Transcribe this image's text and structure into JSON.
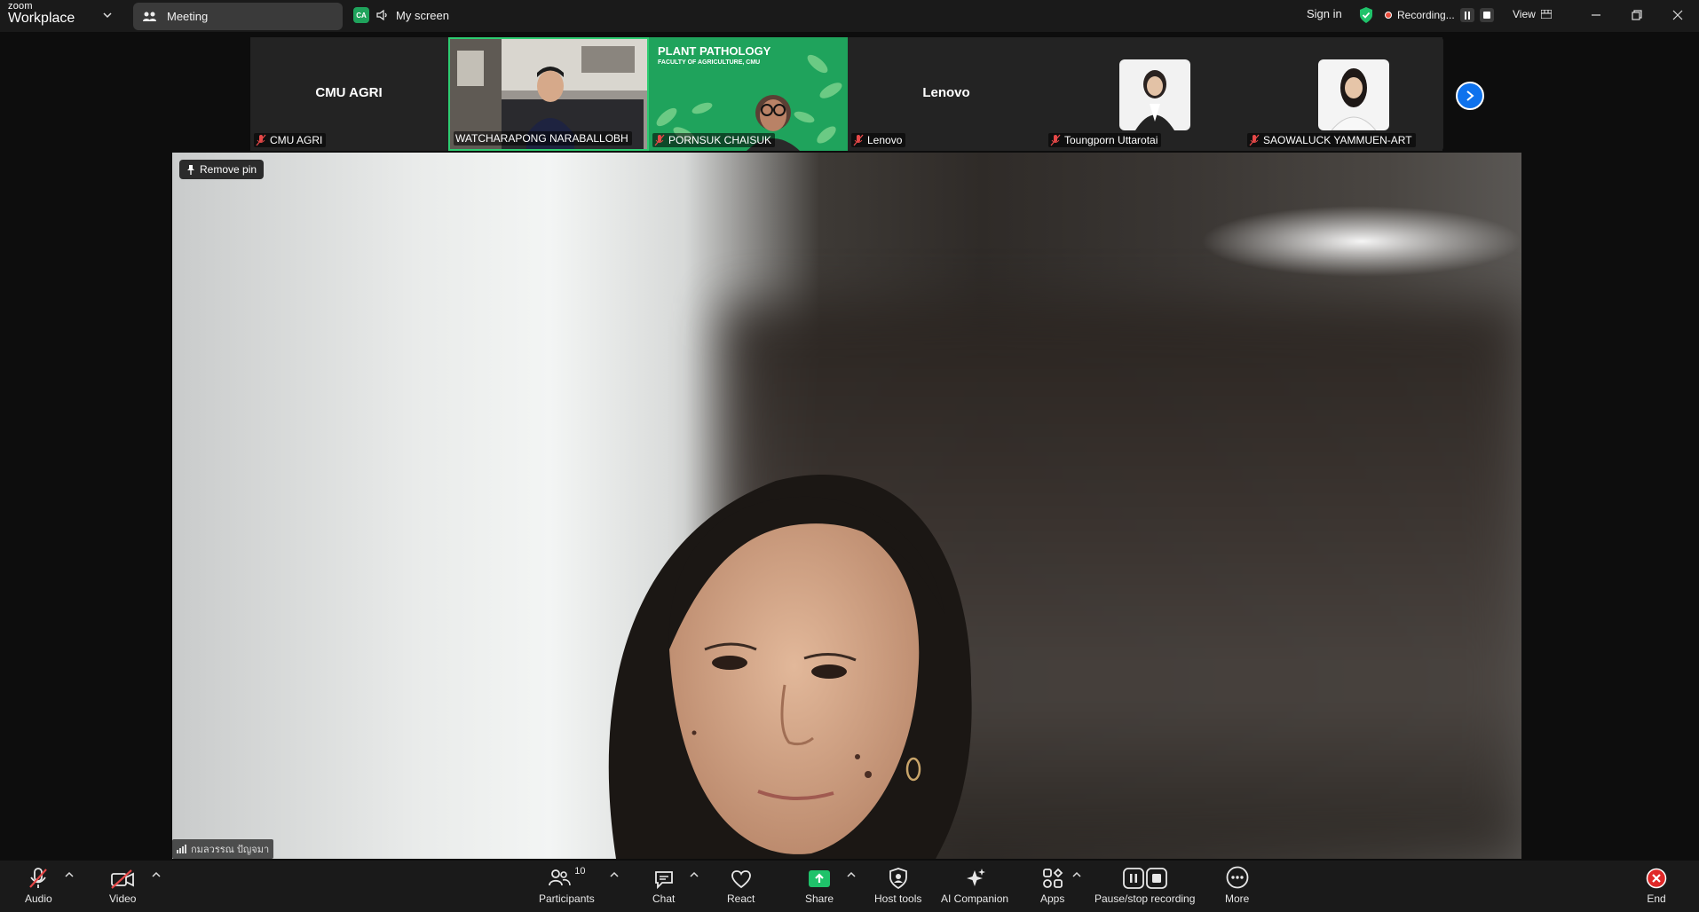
{
  "titlebar": {
    "logo_top": "zoom",
    "logo_bottom": "Workplace",
    "meeting_tab": "Meeting",
    "share_badge": "CA",
    "my_screen": "My screen",
    "sign_in": "Sign in",
    "recording": "Recording...",
    "view": "View"
  },
  "participants_strip": [
    {
      "name": "CMU AGRI",
      "display_name": "CMU AGRI",
      "video": false
    },
    {
      "name": "WATCHARAPONG NARABALLOBH",
      "video": true,
      "active": true
    },
    {
      "name": "PORNSUK CHAISUK",
      "video": true,
      "banner_title": "PLANT PATHOLOGY",
      "banner_sub": "FACULTY OF AGRICULTURE, CMU"
    },
    {
      "name": "Lenovo",
      "display_name": "Lenovo",
      "video": false
    },
    {
      "name": "Toungporn Uttarotai",
      "video": false,
      "photo": true
    },
    {
      "name": "SAOWALUCK YAMMUEN-ART",
      "video": false,
      "photo": true
    }
  ],
  "main_video": {
    "pin_label": "Remove pin",
    "speaker_name": "กมลวรรณ ปัญจมา"
  },
  "toolbar": {
    "audio": "Audio",
    "video": "Video",
    "participants": "Participants",
    "participants_count": "10",
    "chat": "Chat",
    "react": "React",
    "share": "Share",
    "host_tools": "Host tools",
    "ai_companion": "AI Companion",
    "apps": "Apps",
    "pause_stop_recording": "Pause/stop recording",
    "more": "More",
    "end": "End"
  },
  "colors": {
    "accent_green": "#2ecc71",
    "share_green": "#1fc26a",
    "blue": "#0e72ed",
    "end_red": "#e02828",
    "mic_off_red": "#e64848"
  }
}
